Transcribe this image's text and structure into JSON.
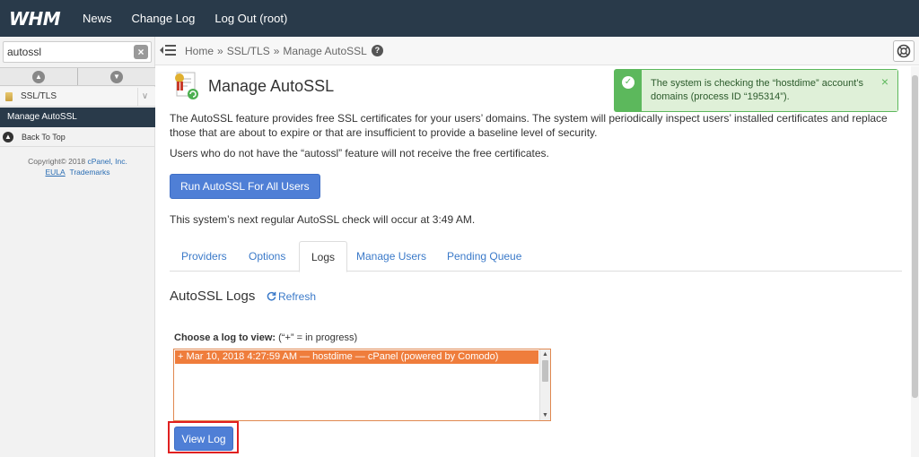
{
  "app": {
    "logo": "WHM"
  },
  "topnav": {
    "news": "News",
    "changelog": "Change Log",
    "logout": "Log Out (root)"
  },
  "sidebar": {
    "search_value": "autossl",
    "category": "SSL/TLS",
    "active_item": "Manage AutoSSL",
    "back_to_top": "Back To Top",
    "copyright_prefix": "Copyright© 2018",
    "copyright_link": "cPanel, Inc.",
    "eula": "EULA",
    "trademarks": "Trademarks"
  },
  "breadcrumb": {
    "home": "Home",
    "sep1": "»",
    "section": "SSL/TLS",
    "sep2": "»",
    "current": "Manage AutoSSL",
    "help_icon": "?"
  },
  "page": {
    "title": "Manage AutoSSL",
    "description": "The AutoSSL feature provides free SSL certificates for your users’ domains. The system will periodically inspect users’ installed certificates and replace those that are about to expire or that are insufficient to provide a baseline level of security.",
    "note": "Users who do not have the “autossl” feature will not receive the free certificates.",
    "run_button": "Run AutoSSL For All Users",
    "next_check": "This system’s next regular AutoSSL check will occur at 3:49 AM."
  },
  "tabs": [
    {
      "label": "Providers"
    },
    {
      "label": "Options"
    },
    {
      "label": "Logs"
    },
    {
      "label": "Manage Users"
    },
    {
      "label": "Pending Queue"
    }
  ],
  "logs": {
    "title": "AutoSSL Logs",
    "refresh": "Refresh",
    "choose_label": "Choose a log to view:",
    "choose_hint": "(“+” = in progress)",
    "entries": [
      "+ Mar 10, 2018 4:27:59 AM — hostdime — cPanel (powered by Comodo)"
    ],
    "view_button": "View Log"
  },
  "notice": {
    "text": "The system is checking the “hostdime” account’s domains (process ID “195314”).",
    "close": "×"
  },
  "colors": {
    "topbar": "#293a4a",
    "primary_button": "#4f7fd6",
    "selected_log": "#ef7d3c",
    "success": "#5cb85c",
    "highlight": "#e02020"
  }
}
